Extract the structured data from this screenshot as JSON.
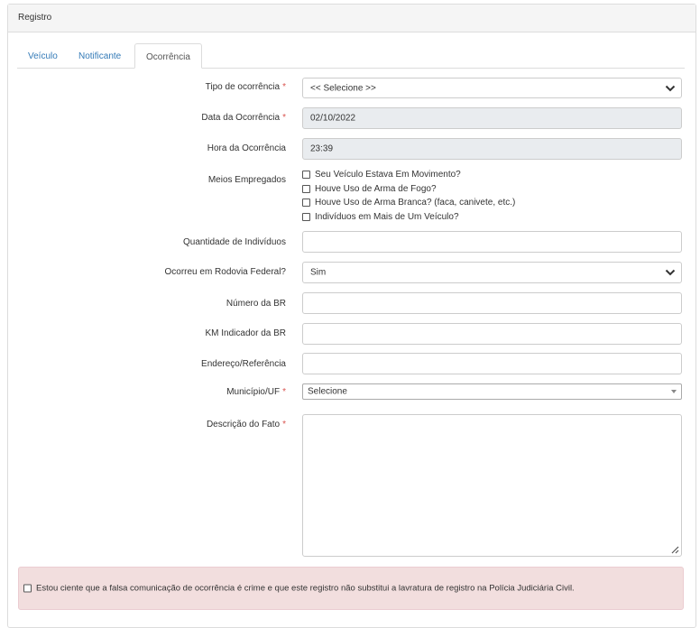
{
  "panel": {
    "title": "Registro"
  },
  "tabs": [
    {
      "label": "Veículo"
    },
    {
      "label": "Notificante"
    },
    {
      "label": "Ocorrência"
    }
  ],
  "form": {
    "tipo": {
      "label": "Tipo de ocorrência",
      "value": "<< Selecione >>"
    },
    "data": {
      "label": "Data da Ocorrência",
      "value": "02/10/2022"
    },
    "hora": {
      "label": "Hora da Ocorrência",
      "value": "23:39"
    },
    "meios": {
      "label": "Meios Empregados",
      "options": [
        "Seu Veículo Estava Em Movimento?",
        "Houve Uso de Arma de Fogo?",
        "Houve Uso de Arma Branca? (faca, canivete, etc.)",
        "Indivíduos em Mais de Um Veículo?"
      ]
    },
    "quantidade": {
      "label": "Quantidade de Indivíduos",
      "value": ""
    },
    "rodovia": {
      "label": "Ocorreu em Rodovia Federal?",
      "value": "Sim"
    },
    "numero_br": {
      "label": "Número da BR",
      "value": ""
    },
    "km_br": {
      "label": "KM Indicador da BR",
      "value": ""
    },
    "endereco": {
      "label": "Endereço/Referência",
      "value": ""
    },
    "municipio": {
      "label": "Município/UF",
      "value": "Selecione"
    },
    "descricao": {
      "label": "Descrição do Fato",
      "value": ""
    },
    "required_mark": "*"
  },
  "alert": {
    "text": "Estou ciente que a falsa comunicação de ocorrência é crime e que este registro não substitui a lavratura de registro na Polícia Judiciária Civil."
  },
  "colors": {
    "link": "#337ab7",
    "required": "#d9534f",
    "alert_bg": "#f2dede"
  }
}
